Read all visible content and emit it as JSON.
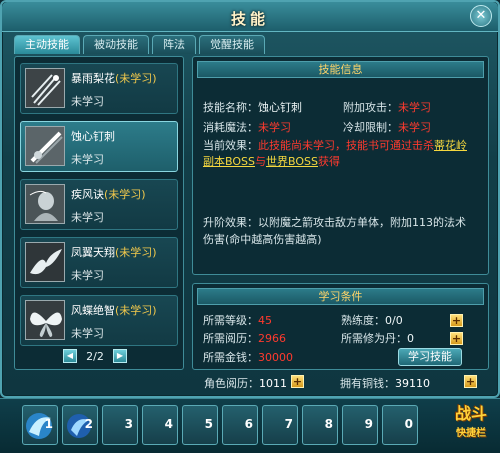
{
  "window": {
    "title": "技能",
    "close": "✕"
  },
  "tabs": [
    "主动技能",
    "被动技能",
    "阵法",
    "觉醒技能"
  ],
  "skills": [
    {
      "name": "暴雨梨花",
      "tag": "(未学习)",
      "state": "未学习",
      "icon": "rain-needle-icon"
    },
    {
      "name": "蚀心钉刺",
      "tag": "",
      "state": "未学习",
      "icon": "spike-icon"
    },
    {
      "name": "疾风诀",
      "tag": "(未学习)",
      "state": "未学习",
      "icon": "wind-spirit-icon"
    },
    {
      "name": "凤翼天翔",
      "tag": "(未学习)",
      "state": "未学习",
      "icon": "phoenix-wing-icon"
    },
    {
      "name": "风蝶绝智",
      "tag": "(未学习)",
      "state": "未学习",
      "icon": "butterfly-icon"
    }
  ],
  "pager": {
    "text": "2/2",
    "prev": "◀",
    "next": "▶"
  },
  "info": {
    "header": "技能信息",
    "name_label": "技能名称：",
    "name_value": "蚀心钉刺",
    "attack_label": "附加攻击：",
    "attack_value": "未学习",
    "mana_label": "消耗魔法：",
    "mana_value": "未学习",
    "cooldown_label": "冷却限制：",
    "cooldown_value": "未学习",
    "effect_label": "当前效果：",
    "effect_part1": "此技能尚未学习，技能书可通过击杀",
    "effect_link1": "蒂花岭",
    "effect_link2": "副本BOSS",
    "effect_or": "与",
    "effect_link3": "世界BOSS",
    "effect_end": "获得",
    "upgrade_line1": "升阶效果：以附魔之箭攻击敌方单体，附加113的法术",
    "upgrade_line2": "伤害(命中越高伤害越高)"
  },
  "learn": {
    "header": "学习条件",
    "level_label": "所需等级：",
    "level_value": "45",
    "skill_label": "熟练度：",
    "skill_value": "0/0",
    "exp_label": "所需阅历：",
    "exp_value": "2966",
    "pill_label": "所需修为丹：",
    "pill_value": "0",
    "gold_label": "所需金钱：",
    "gold_value": "30000",
    "learn_button": "学习技能",
    "plus": "+"
  },
  "footer": {
    "exp_label": "角色阅历：",
    "exp_value": "1011",
    "money_label": "拥有铜钱：",
    "money_value": "39110",
    "plus": "+"
  },
  "hotbar": {
    "slots": [
      "1",
      "2",
      "3",
      "4",
      "5",
      "6",
      "7",
      "8",
      "9",
      "0"
    ],
    "fight_big": "战斗",
    "fight_small": "快捷栏"
  },
  "colors": {
    "accent": "#3f8c98",
    "warn": "#ff3a2e",
    "gold": "#f5d73f"
  }
}
